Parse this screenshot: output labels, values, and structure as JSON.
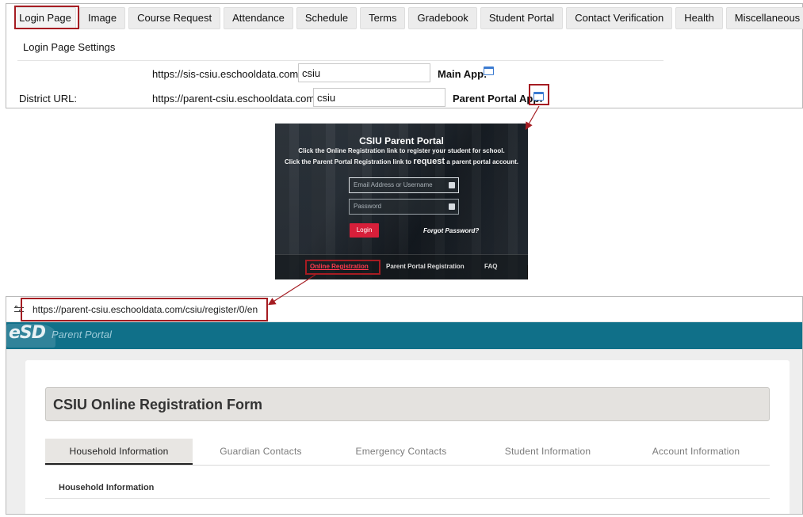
{
  "settings": {
    "tabs": [
      {
        "label": "Login Page"
      },
      {
        "label": "Image"
      },
      {
        "label": "Course Request"
      },
      {
        "label": "Attendance"
      },
      {
        "label": "Schedule"
      },
      {
        "label": "Terms"
      },
      {
        "label": "Gradebook"
      },
      {
        "label": "Student Portal"
      },
      {
        "label": "Contact Verification"
      },
      {
        "label": "Health"
      },
      {
        "label": "Miscellaneous"
      }
    ],
    "section_title": "Login Page Settings",
    "main_app": {
      "prefix": "https://sis-csiu.eschooldata.com/",
      "value": "csiu",
      "label": "Main App:"
    },
    "parent_portal": {
      "field_label": "District URL:",
      "prefix": "https://parent-csiu.eschooldata.com/",
      "value": "csiu",
      "label": "Parent Portal App:"
    }
  },
  "portal": {
    "title": "CSIU Parent Portal",
    "line1": "Click the Online Registration link to register your student for school.",
    "line2_pre": "Click the Parent Portal Registration link to",
    "line2_big": "request",
    "line2_post": "a parent portal account.",
    "email_placeholder": "Email Address or Username",
    "password_placeholder": "Password",
    "login_label": "Login",
    "forgot_label": "Forgot Password?",
    "links": {
      "online_registration": "Online Registration",
      "parent_portal_registration": "Parent Portal Registration",
      "faq": "FAQ"
    }
  },
  "browser": {
    "url": "https://parent-csiu.eschooldata.com/csiu/register/0/en",
    "logo": "eSD",
    "app_name": "Parent Portal",
    "form_title": "CSIU Online Registration Form",
    "tabs": [
      {
        "label": "Household Information"
      },
      {
        "label": "Guardian Contacts"
      },
      {
        "label": "Emergency Contacts"
      },
      {
        "label": "Student Information"
      },
      {
        "label": "Account Information"
      }
    ],
    "subsection": "Household Information"
  },
  "colors": {
    "highlight": "#a51c22",
    "esd_header": "#107089",
    "login_button": "#d71f3a",
    "link_red": "#ff3b4e"
  }
}
